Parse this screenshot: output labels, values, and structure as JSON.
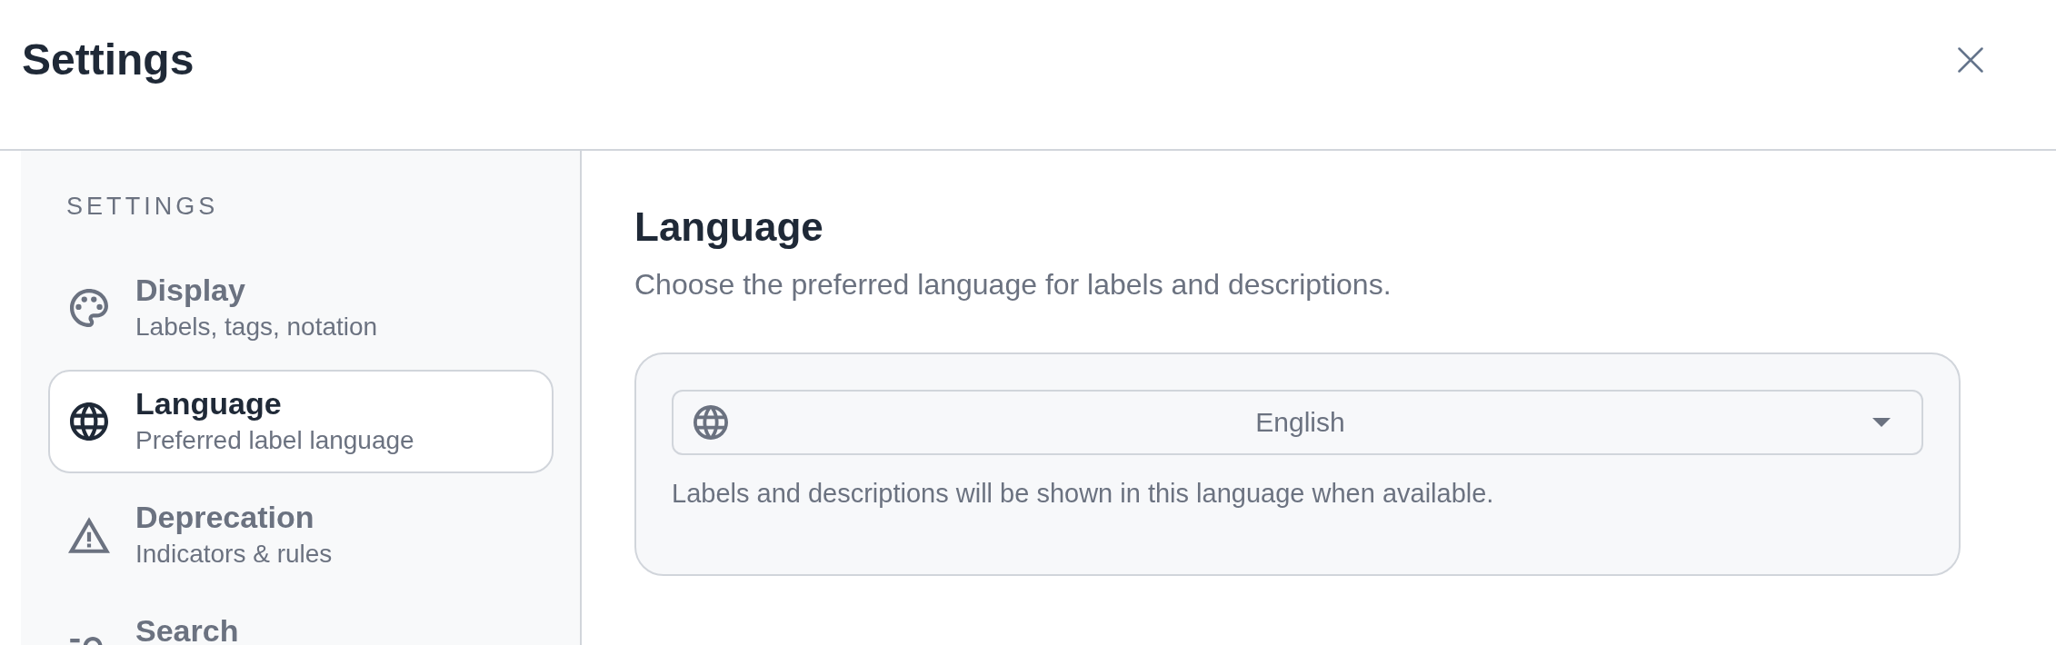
{
  "header": {
    "title": "Settings"
  },
  "sidebar": {
    "heading": "SETTINGS",
    "items": [
      {
        "title": "Display",
        "subtitle": "Labels, tags, notation",
        "selected": false
      },
      {
        "title": "Language",
        "subtitle": "Preferred label language",
        "selected": true
      },
      {
        "title": "Deprecation",
        "subtitle": "Indicators & rules",
        "selected": false
      },
      {
        "title": "Search",
        "selected": false
      }
    ]
  },
  "panel": {
    "title": "Language",
    "description": "Choose the preferred language for labels and descriptions.",
    "language_select": {
      "value": "English"
    },
    "help_text": "Labels and descriptions will be shown in this language when available."
  }
}
